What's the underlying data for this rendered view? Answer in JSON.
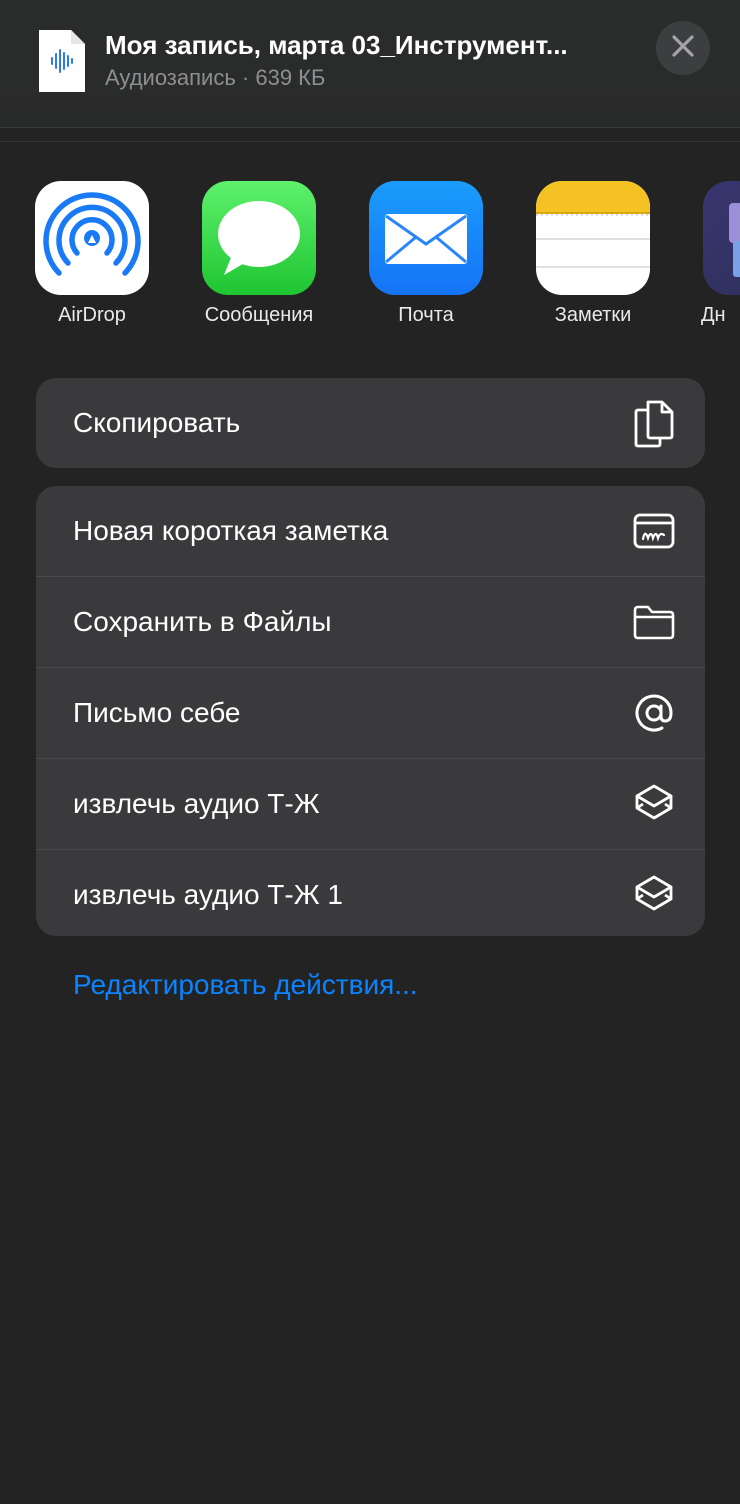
{
  "header": {
    "title": "Моя запись, марта 03_Инструмент...",
    "subtitle": "Аудиозапись · 639 КБ",
    "file_icon": "audio-file-icon",
    "close_icon": "close-icon"
  },
  "apps": [
    {
      "label": "AirDrop",
      "icon": "airdrop-icon"
    },
    {
      "label": "Сообщения",
      "icon": "messages-icon"
    },
    {
      "label": "Почта",
      "icon": "mail-icon"
    },
    {
      "label": "Заметки",
      "icon": "notes-icon"
    },
    {
      "label": "Дн",
      "icon": "partial-app-icon"
    }
  ],
  "group1": [
    {
      "label": "Скопировать",
      "icon": "copy-icon"
    }
  ],
  "group2": [
    {
      "label": "Новая короткая заметка",
      "icon": "quick-note-icon"
    },
    {
      "label": "Сохранить в Файлы",
      "icon": "folder-icon"
    },
    {
      "label": "Письмо себе",
      "icon": "at-icon"
    },
    {
      "label": "извлечь аудио Т-Ж",
      "icon": "shortcuts-icon"
    },
    {
      "label": "извлечь аудио Т-Ж 1",
      "icon": "shortcuts-icon"
    }
  ],
  "edit_actions": "Редактировать действия...",
  "colors": {
    "background": "#232323",
    "cell": "#3a3a3c",
    "accent": "#0a84ff",
    "secondary_text": "#8f8f93"
  }
}
